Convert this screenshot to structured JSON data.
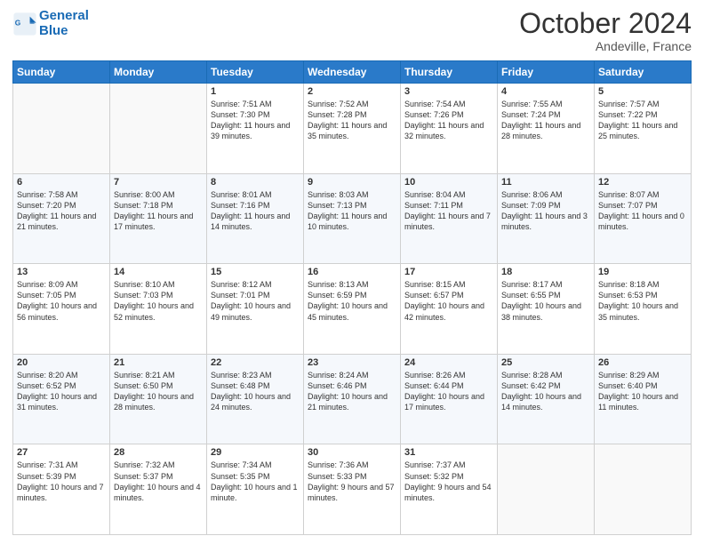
{
  "header": {
    "logo_line1": "General",
    "logo_line2": "Blue",
    "month": "October 2024",
    "location": "Andeville, France"
  },
  "weekdays": [
    "Sunday",
    "Monday",
    "Tuesday",
    "Wednesday",
    "Thursday",
    "Friday",
    "Saturday"
  ],
  "weeks": [
    [
      {
        "day": "",
        "text": ""
      },
      {
        "day": "",
        "text": ""
      },
      {
        "day": "1",
        "text": "Sunrise: 7:51 AM\nSunset: 7:30 PM\nDaylight: 11 hours and 39 minutes."
      },
      {
        "day": "2",
        "text": "Sunrise: 7:52 AM\nSunset: 7:28 PM\nDaylight: 11 hours and 35 minutes."
      },
      {
        "day": "3",
        "text": "Sunrise: 7:54 AM\nSunset: 7:26 PM\nDaylight: 11 hours and 32 minutes."
      },
      {
        "day": "4",
        "text": "Sunrise: 7:55 AM\nSunset: 7:24 PM\nDaylight: 11 hours and 28 minutes."
      },
      {
        "day": "5",
        "text": "Sunrise: 7:57 AM\nSunset: 7:22 PM\nDaylight: 11 hours and 25 minutes."
      }
    ],
    [
      {
        "day": "6",
        "text": "Sunrise: 7:58 AM\nSunset: 7:20 PM\nDaylight: 11 hours and 21 minutes."
      },
      {
        "day": "7",
        "text": "Sunrise: 8:00 AM\nSunset: 7:18 PM\nDaylight: 11 hours and 17 minutes."
      },
      {
        "day": "8",
        "text": "Sunrise: 8:01 AM\nSunset: 7:16 PM\nDaylight: 11 hours and 14 minutes."
      },
      {
        "day": "9",
        "text": "Sunrise: 8:03 AM\nSunset: 7:13 PM\nDaylight: 11 hours and 10 minutes."
      },
      {
        "day": "10",
        "text": "Sunrise: 8:04 AM\nSunset: 7:11 PM\nDaylight: 11 hours and 7 minutes."
      },
      {
        "day": "11",
        "text": "Sunrise: 8:06 AM\nSunset: 7:09 PM\nDaylight: 11 hours and 3 minutes."
      },
      {
        "day": "12",
        "text": "Sunrise: 8:07 AM\nSunset: 7:07 PM\nDaylight: 11 hours and 0 minutes."
      }
    ],
    [
      {
        "day": "13",
        "text": "Sunrise: 8:09 AM\nSunset: 7:05 PM\nDaylight: 10 hours and 56 minutes."
      },
      {
        "day": "14",
        "text": "Sunrise: 8:10 AM\nSunset: 7:03 PM\nDaylight: 10 hours and 52 minutes."
      },
      {
        "day": "15",
        "text": "Sunrise: 8:12 AM\nSunset: 7:01 PM\nDaylight: 10 hours and 49 minutes."
      },
      {
        "day": "16",
        "text": "Sunrise: 8:13 AM\nSunset: 6:59 PM\nDaylight: 10 hours and 45 minutes."
      },
      {
        "day": "17",
        "text": "Sunrise: 8:15 AM\nSunset: 6:57 PM\nDaylight: 10 hours and 42 minutes."
      },
      {
        "day": "18",
        "text": "Sunrise: 8:17 AM\nSunset: 6:55 PM\nDaylight: 10 hours and 38 minutes."
      },
      {
        "day": "19",
        "text": "Sunrise: 8:18 AM\nSunset: 6:53 PM\nDaylight: 10 hours and 35 minutes."
      }
    ],
    [
      {
        "day": "20",
        "text": "Sunrise: 8:20 AM\nSunset: 6:52 PM\nDaylight: 10 hours and 31 minutes."
      },
      {
        "day": "21",
        "text": "Sunrise: 8:21 AM\nSunset: 6:50 PM\nDaylight: 10 hours and 28 minutes."
      },
      {
        "day": "22",
        "text": "Sunrise: 8:23 AM\nSunset: 6:48 PM\nDaylight: 10 hours and 24 minutes."
      },
      {
        "day": "23",
        "text": "Sunrise: 8:24 AM\nSunset: 6:46 PM\nDaylight: 10 hours and 21 minutes."
      },
      {
        "day": "24",
        "text": "Sunrise: 8:26 AM\nSunset: 6:44 PM\nDaylight: 10 hours and 17 minutes."
      },
      {
        "day": "25",
        "text": "Sunrise: 8:28 AM\nSunset: 6:42 PM\nDaylight: 10 hours and 14 minutes."
      },
      {
        "day": "26",
        "text": "Sunrise: 8:29 AM\nSunset: 6:40 PM\nDaylight: 10 hours and 11 minutes."
      }
    ],
    [
      {
        "day": "27",
        "text": "Sunrise: 7:31 AM\nSunset: 5:39 PM\nDaylight: 10 hours and 7 minutes."
      },
      {
        "day": "28",
        "text": "Sunrise: 7:32 AM\nSunset: 5:37 PM\nDaylight: 10 hours and 4 minutes."
      },
      {
        "day": "29",
        "text": "Sunrise: 7:34 AM\nSunset: 5:35 PM\nDaylight: 10 hours and 1 minute."
      },
      {
        "day": "30",
        "text": "Sunrise: 7:36 AM\nSunset: 5:33 PM\nDaylight: 9 hours and 57 minutes."
      },
      {
        "day": "31",
        "text": "Sunrise: 7:37 AM\nSunset: 5:32 PM\nDaylight: 9 hours and 54 minutes."
      },
      {
        "day": "",
        "text": ""
      },
      {
        "day": "",
        "text": ""
      }
    ]
  ]
}
